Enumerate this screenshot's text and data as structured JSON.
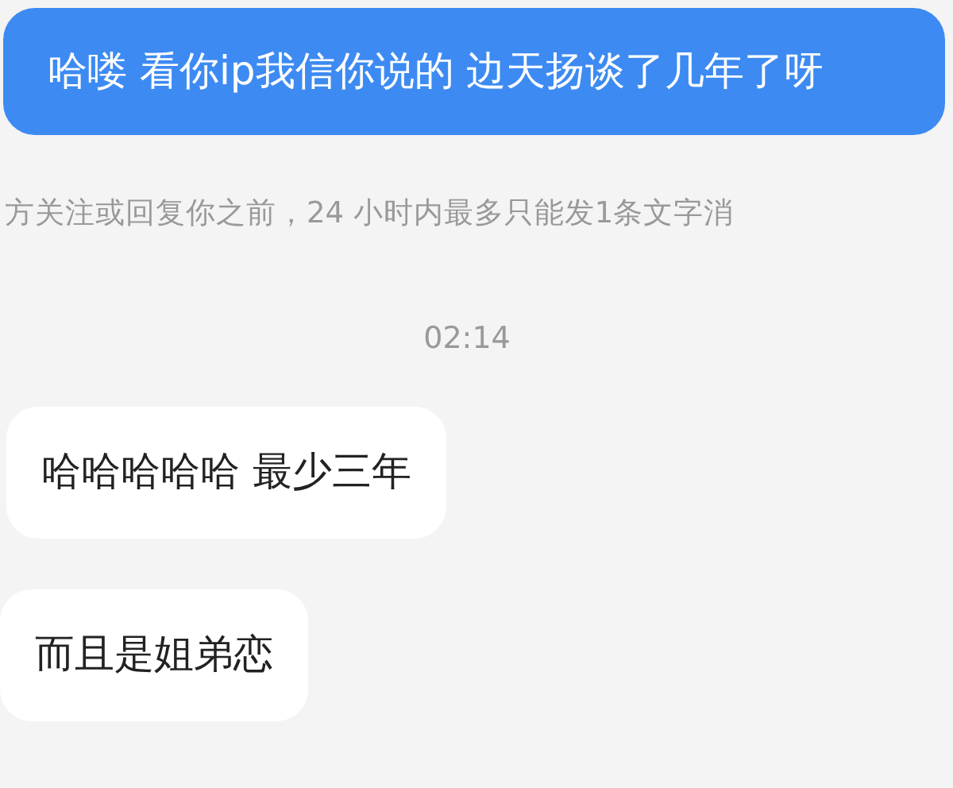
{
  "messages": [
    {
      "kind": "sent",
      "text": "哈喽 看你ip我信你说的 边天扬谈了几年了呀"
    },
    {
      "kind": "notice",
      "text": "方关注或回复你之前，24 小时内最多只能发1条文字消"
    },
    {
      "kind": "time",
      "text": "02:14"
    },
    {
      "kind": "received",
      "text": "哈哈哈哈哈 最少三年"
    },
    {
      "kind": "received",
      "text": "而且是姐弟恋"
    }
  ]
}
